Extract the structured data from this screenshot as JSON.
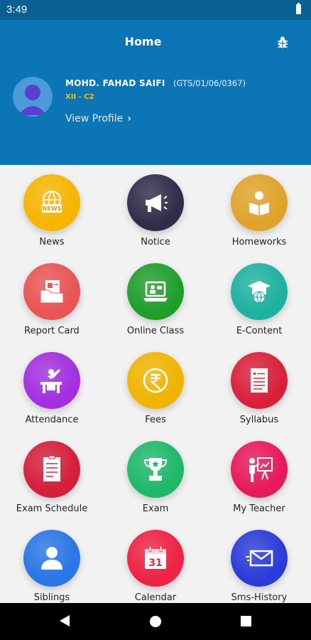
{
  "status_bar": {
    "time": "3:49"
  },
  "header": {
    "title": "Home",
    "bug_icon": "bug-icon",
    "color": "#0b75b5"
  },
  "profile": {
    "name": "MOHD. FAHAD SAIFI",
    "id": "(GTS/01/06/0367)",
    "class": "XII - C2",
    "view_profile": "View Profile"
  },
  "menu": [
    {
      "label": "News",
      "icon": "news-icon",
      "color": "#f7b500"
    },
    {
      "label": "Notice",
      "icon": "megaphone-icon",
      "color": "#2f2d4a"
    },
    {
      "label": "Homeworks",
      "icon": "homework-icon",
      "color": "#e0a32a"
    },
    {
      "label": "Report Card",
      "icon": "report-card-icon",
      "color": "#ea5456"
    },
    {
      "label": "Online Class",
      "icon": "online-class-icon",
      "color": "#1f9e2c"
    },
    {
      "label": "E-Content",
      "icon": "e-content-icon",
      "color": "#1eb1a0"
    },
    {
      "label": "Attendance",
      "icon": "attendance-icon",
      "color": "#a32fe0"
    },
    {
      "label": "Fees",
      "icon": "rupee-icon",
      "color": "#f0b400"
    },
    {
      "label": "Syllabus",
      "icon": "syllabus-icon",
      "color": "#d9203a"
    },
    {
      "label": "Exam Schedule",
      "icon": "exam-schedule-icon",
      "color": "#d41f3c"
    },
    {
      "label": "Exam",
      "icon": "trophy-icon",
      "color": "#1fb86a"
    },
    {
      "label": "My Teacher",
      "icon": "teacher-icon",
      "color": "#e8195a"
    },
    {
      "label": "Siblings",
      "icon": "person-icon",
      "color": "#2a76e6"
    },
    {
      "label": "Calendar",
      "icon": "calendar-icon",
      "color": "#ee2244"
    },
    {
      "label": "Sms-History",
      "icon": "envelope-icon",
      "color": "#2a3bd8"
    }
  ],
  "calendar_day": "31",
  "nav": {
    "back": "back-icon",
    "home": "home-icon",
    "recents": "recents-icon"
  }
}
